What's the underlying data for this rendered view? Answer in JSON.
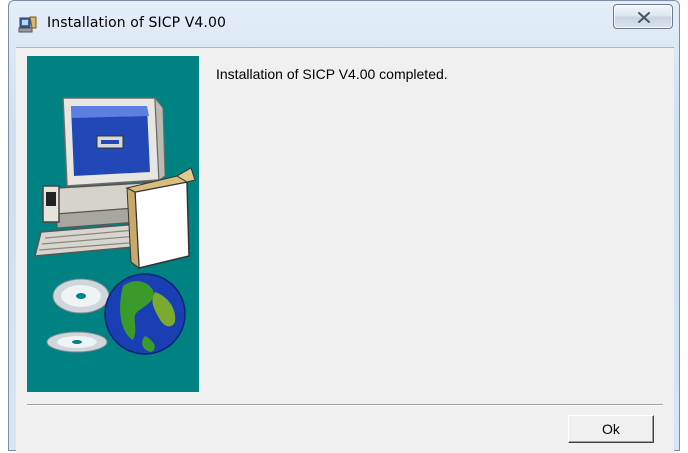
{
  "window": {
    "title": "Installation of SICP V4.00",
    "close_label": "Close",
    "title_icon": "installer-icon"
  },
  "dialog": {
    "message": "Installation of SICP V4.00 completed.",
    "ok_label": "Ok",
    "side_image": "computer-with-cds-and-globe-illustration"
  },
  "colors": {
    "side_panel_bg": "#008282",
    "dialog_bg": "#f0f0f0",
    "titlebar_bg": "#cddff0"
  }
}
